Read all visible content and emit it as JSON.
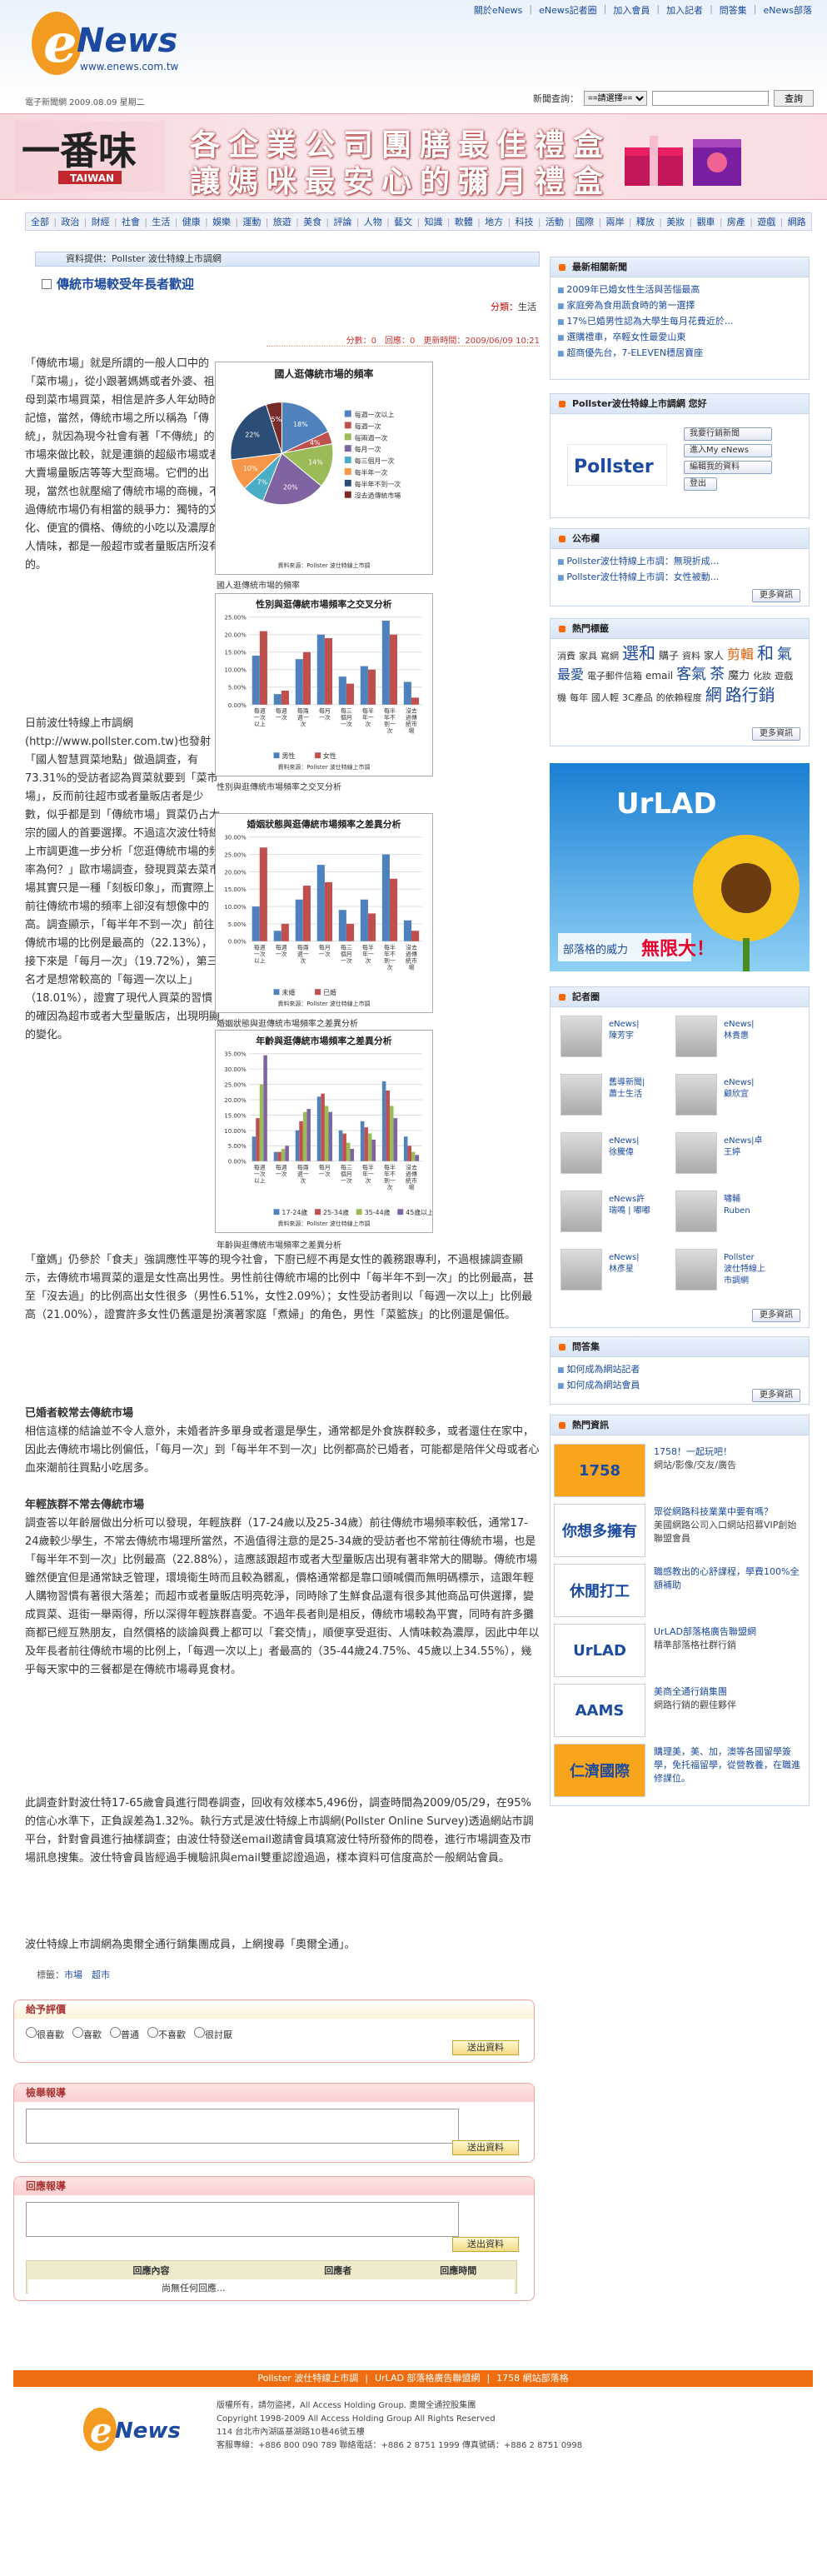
{
  "header": {
    "top_links": [
      "關於eNews",
      "eNews記者圈",
      "加入會員",
      "加入記者",
      "問答集",
      "eNews部落"
    ],
    "site_url": "www.enews.com.tw",
    "date_line": "電子新聞網 2009.08.09 星期二",
    "search_label": "新聞查詢：",
    "search_select": "==請選擇==",
    "search_button": "查詢"
  },
  "banner": {
    "brand_zh": "一番味",
    "brand_en": "TAIWAN",
    "line1": "各企業公司團膳最佳禮盒",
    "line2": "讓媽咪最安心的彌月禮盒"
  },
  "nav": [
    "全部",
    "政治",
    "財經",
    "社會",
    "生活",
    "健康",
    "娛樂",
    "運動",
    "旅遊",
    "美食",
    "評論",
    "人物",
    "藝文",
    "知識",
    "軟體",
    "地方",
    "科技",
    "活動",
    "國際",
    "兩岸",
    "釋放",
    "美妝",
    "觀車",
    "房產",
    "遊戲",
    "網路"
  ],
  "article": {
    "source": "資料提供：Pollster 波仕特線上市調網",
    "title": "傳統市場較受年長者歡迎",
    "category_label": "分類：",
    "category": "生活",
    "meta": "分數：0　回應：0　更新時間：2009/06/09 10:21",
    "intro": "「傳統市場」就是所謂的一般人口中的「菜市場」，從小跟著媽媽或者外婆、祖母到菜市場買菜，相信是許多人年幼時的記憶，當然，傳統市場之所以稱為「傳統」，就因為現今社會有著「不傳統」的市場來做比較，就是連鎖的超級市場或者大賣場量販店等等大型商場。它們的出現，當然也就壓縮了傳統市場的商機，不過傳統市場仍有相當的競爭力：獨特的文化、便宜的價格、傳統的小吃以及濃厚的人情味，都是一般超市或者量販店所沒有的。",
    "p2": "日前波仕特線上市調網(http://www.pollster.com.tw)也發射「國人智慧買菜地點」做過調查，有73.31%的受訪者認為買菜就要到「菜市場」，反而前往超市或者量販店者是少數，似乎都是到「傳統市場」買菜仍占大宗的國人的首要選擇。不過這次波仕特線上市調更進一步分析「您逛傳統市場的頻率為何？」歐市場調查，發現買菜去菜市場其實只是一種「刻板印象」，而實際上前往傳統市場的頻率上卻沒有想像中的高。調查顯示，「每半年不到一次」前往傳統市場的比例是最高的（22.13%），接下來是「每月一次」（19.72%），第三名才是想常較高的「每週一次以上」（18.01%），證實了現代人買菜的習慣的確因為超市或者大型量販店，出現明顯的變化。",
    "p3": "「童媽」仍參於「食夫」強調應性平等的現今社會，下廚已經不再是女性的義務跟專利，不過根據調查顯示，去傳統市場買菜的還是女性高出男性。男性前往傳統市場的比例中「每半年不到一次」的比例最高，甚至「沒去過」的比例高出女性很多（男性6.51%，女性2.09%）；女性受訪者則以「每週一次以上」比例最高（21.00%），證實許多女性仍舊還是扮演著家庭「煮婦」的角色，男性「菜籃族」的比例還是偏低。",
    "p4h": "已婚者較常去傳統市場",
    "p4": "相信這樣的結論並不令人意外，未婚者許多單身或者還是學生，通常都是外食族群較多，或者還住在家中，因此去傳統市場比例偏低，「每月一次」到「每半年不到一次」比例都高於已婚者，可能都是陪伴父母或者心血來潮前往買點小吃居多。",
    "p5h": "年輕族群不常去傳統市場",
    "p5": "調查答以年齡層做出分析可以發現，年輕族群（17-24歲以及25-34歲）前往傳統市場頻率較低，通常17-24歲較少學生，不常去傳統市場理所當然，不過值得注意的是25-34歲的受訪者也不常前往傳統市場，也是「每半年不到一次」比例最高（22.88%），這應該跟超市或者大型量販店出現有著非常大的關聯。傳統市場雖然便宜但是通常缺乏管理，環境衛生時而且較為髒亂，價格通常都是靠口頭喊價而無明碼標示，這跟年輕人購物習慣有著很大落差；而超市或者量販店明亮乾淨，同時除了生鮮食品還有很多其他商品可供選擇，變成買菜、逛街一舉兩得，所以深得年輕族群喜愛。不過年長者則是相反，傳統市場較為平實，同時有許多攤商都已經互熟朋友，自然價格的談論與費上都可以「套交情」，順便享受逛街、人情味較為濃厚，因此中年以及年長者前往傳統市場的比例上，「每週一次以上」者最高的（35-44歲24.75%、45歲以上34.55%），幾乎每天家中的三餐都是在傳統市場尋覓食材。",
    "p6": "此調查針對波仕特17-65歲會員進行問卷調查，回收有效樣本5,496份，調查時間為2009/05/29，在95%的信心水準下，正負誤差為1.32%。執行方式是波仕特線上市調網(Pollster Online Survey)透過網站市調平台，針對會員進行抽樣調查；由波仕特發送email邀請會員填寫波仕特所發佈的問卷，進行市場調查及市場訊息搜集。波仕特會員皆經過手機驗訊與email雙重認證過過，樣本資料可信度高於一般網站會員。",
    "p7": "波仕特線上市調網為奧爾全通行銷集團成員，上網搜尋「奧爾全通」。",
    "tags_label": "標籤：",
    "tags": [
      "市場",
      "超市"
    ]
  },
  "charts": [
    {
      "title": "國人逛傳統市場的頻率",
      "caption": "國人逛傳統市場的頻率",
      "source": "資料來源：Pollster 波仕特線上市調",
      "legend": [
        "每週一次以上",
        "每週一次",
        "每兩週一次",
        "每月一次",
        "每三個月一次",
        "每半年一次",
        "每半年不到一次",
        "沒去過傳統市場"
      ]
    },
    {
      "title": "性別與逛傳統市場頻率之交叉分析",
      "caption": "性別與逛傳統市場頻率之交叉分析",
      "source": "資料來源：Pollster 波仕特線上市調",
      "legend": [
        "男性",
        "女性"
      ]
    },
    {
      "title": "婚姻狀態與逛傳統市場頻率之差異分析",
      "caption": "婚姻狀態與逛傳統市場頻率之差異分析",
      "source": "資料來源：Pollster 波仕特線上市調",
      "legend": [
        "未婚",
        "已婚"
      ]
    },
    {
      "title": "年齡與逛傳統市場頻率之差異分析",
      "caption": "年齡與逛傳統市場頻率之差異分析",
      "source": "資料來源：Pollster 波仕特線上市調",
      "legend": [
        "17-24歲",
        "25-34歲",
        "35-44歲",
        "45歲以上"
      ]
    }
  ],
  "chart_data": [
    {
      "type": "pie",
      "title": "國人逛傳統市場的頻率",
      "labels": [
        "每週一次以上",
        "每週一次",
        "每兩週一次",
        "每月一次",
        "每三個月一次",
        "每半年一次",
        "每半年不到一次",
        "沒去過傳統市場"
      ],
      "values": [
        18,
        4,
        14,
        20,
        7,
        10,
        22,
        5
      ],
      "printed_labels": [
        "18%",
        "4%",
        "14%",
        "20%",
        "7%",
        "10%",
        "22%",
        "5%"
      ]
    },
    {
      "type": "bar",
      "title": "性別與逛傳統市場頻率之交叉分析",
      "categories": [
        "每週一次以上",
        "每週一次",
        "每兩週一次",
        "每月一次",
        "每三個月一次",
        "每半年一次",
        "每半年不到一次",
        "沒去過傳統市場"
      ],
      "ylim": [
        0,
        25
      ],
      "yticks": [
        "0.00%",
        "5.00%",
        "10.00%",
        "15.00%",
        "20.00%",
        "25.00%"
      ],
      "series": [
        {
          "name": "男性",
          "values": [
            14,
            3,
            13,
            20,
            8,
            11,
            24,
            6.5
          ]
        },
        {
          "name": "女性",
          "values": [
            21,
            4,
            15,
            19,
            6,
            10,
            20,
            2
          ]
        }
      ]
    },
    {
      "type": "bar",
      "title": "婚姻狀態與逛傳統市場頻率之差異分析",
      "categories": [
        "每週一次以上",
        "每週一次",
        "每兩週一次",
        "每月一次",
        "每三個月一次",
        "每半年一次",
        "每半年不到一次",
        "沒去過傳統市場"
      ],
      "ylim": [
        0,
        30
      ],
      "yticks": [
        "0.00%",
        "5.00%",
        "10.00%",
        "15.00%",
        "20.00%",
        "25.00%",
        "30.00%"
      ],
      "series": [
        {
          "name": "未婚",
          "values": [
            10,
            3,
            12,
            22,
            9,
            12,
            25,
            6
          ]
        },
        {
          "name": "已婚",
          "values": [
            27,
            5,
            16,
            17,
            5,
            8,
            18,
            3
          ]
        }
      ]
    },
    {
      "type": "bar",
      "title": "年齡與逛傳統市場頻率之差異分析",
      "categories": [
        "每週一次以上",
        "每週一次",
        "每兩週一次",
        "每月一次",
        "每三個月一次",
        "每半年一次",
        "每半年不到一次",
        "沒去過傳統市場"
      ],
      "ylim": [
        0,
        35
      ],
      "yticks": [
        "0.00%",
        "5.00%",
        "10.00%",
        "15.00%",
        "20.00%",
        "25.00%",
        "30.00%",
        "35.00%"
      ],
      "series": [
        {
          "name": "17-24歲",
          "values": [
            8,
            3,
            10,
            21,
            10,
            13,
            26,
            8
          ]
        },
        {
          "name": "25-34歲",
          "values": [
            14,
            3,
            13,
            22,
            9,
            11,
            23,
            5
          ]
        },
        {
          "name": "35-44歲",
          "values": [
            25,
            4,
            16,
            18,
            6,
            9,
            18,
            3
          ]
        },
        {
          "name": "45歲以上",
          "values": [
            34.5,
            5,
            17,
            16,
            4,
            7,
            14,
            2
          ]
        }
      ]
    }
  ],
  "sidebar": {
    "latest_title": "最新相關新聞",
    "latest": [
      "2009年已婚女性生活與苦惱最高",
      "家庭旁為食用蔬食時的第一選擇",
      "17%已婚男性認為大學生每月花費近於...",
      "選購禮車，卒輕女性最愛山東",
      "超商優先台，7-ELEVEN穩居寶座"
    ],
    "pollster_title": "Pollster波仕特線上市調網 您好",
    "pollster_buttons": [
      "我要行銷新聞",
      "進入My eNews",
      "編輯我的資料",
      "登出"
    ],
    "notice_title": "公布欄",
    "notice": [
      "Pollster波仕特線上市調：無現折成...",
      "Pollster波仕特線上市調：女性被動..."
    ],
    "hot_title": "熱門標籤",
    "hot_words": [
      "消費",
      "家具",
      "寫網",
      "選和",
      "購子",
      "資料",
      "家人",
      "剪輯",
      "和",
      "氣",
      "最愛",
      "電子郵件信箱",
      "email",
      "客氣",
      "茶",
      "魔力",
      "化妝",
      "遊戲機",
      "每年",
      "國人輕",
      "3C產品",
      "的依賴程度",
      "網",
      "路行銷"
    ],
    "ad_title": "UrLAD",
    "ad_sub": "部落格的威力",
    "ad_big": "無限大！",
    "blogger_title": "記者圈",
    "bloggers": [
      [
        "eNews|",
        "陳芳宇"
      ],
      [
        "eNews|",
        "林貴惠"
      ],
      [
        "舊導新聞|",
        "蕭士生活"
      ],
      [
        "eNews|",
        "顧欣宜"
      ],
      [
        "eNews|",
        "徐騰偉"
      ],
      [
        "eNews|卓",
        "王婷"
      ],
      [
        "eNews許",
        "瑞鳴 | 嘟嘟"
      ],
      [
        "嘯輔",
        "Ruben"
      ],
      [
        "eNews|",
        "林彥星"
      ],
      [
        "Pollster",
        "波仕特線上",
        "市調網"
      ]
    ],
    "qa_title": "問答集",
    "qa": [
      "如何成為網站記者",
      "如何成為網站會員"
    ],
    "hot_info_title": "熱門資訊",
    "hot_info": [
      [
        "1758",
        "1758！一起玩吧！",
        "網站/影像/交友/廣告"
      ],
      [
        "你想多擁有",
        "眾從網路科技業業中要有嗎？",
        "美國網路公司入口網站招募VIP創始聯盟會員"
      ],
      [
        "休閒打工",
        "職感教出的心舒課程，學費100%全額補助"
      ],
      [
        "UrLAD",
        "UrLAD部落格廣告聯盟網",
        "精準部落格社群行銷"
      ],
      [
        "AAMS",
        "美商全通行銷集團",
        "網路行銷的觀佳夥伴"
      ],
      [
        "仁濟國際",
        "購理美，美、加，澳等各國留學簽學，免托福留學，從營教養，在職進修課位。"
      ]
    ],
    "more": "更多資訊"
  },
  "forms": {
    "rate_title": "給予評價",
    "rate_options": [
      "很喜歡",
      "喜歡",
      "普通",
      "不喜歡",
      "很討厭"
    ],
    "send": "送出資料",
    "report_title": "檢舉報導",
    "reply_title": "回應報導",
    "reply_headers": [
      "回應內容",
      "回應者",
      "回應時間"
    ],
    "reply_empty": "尚無任何回應..."
  },
  "footer": {
    "links": [
      "Pollster 波仕特線上市調",
      "UrLAD 部落格廣告聯盟網",
      "1758 網站部落格"
    ],
    "lines": [
      "版權所有，請勿盜拷，All Access Holding Group. 奧爾全通控股集團",
      "Copyright 1998-2009 All Access Holding Group All Rights Reserved",
      "114 台北市內湖區基湖路10巷46號五樓",
      "客服專線：+886 800 090 789 聯絡電話：+886 2 8751 1999 傳真號碼：+886 2 8751 0998"
    ]
  },
  "colors": {
    "brand_blue": "#1b4aa0",
    "accent_orange": "#f06d0f",
    "link_blue": "#1b4aa0",
    "pink_banner": "#f6d7dc"
  }
}
